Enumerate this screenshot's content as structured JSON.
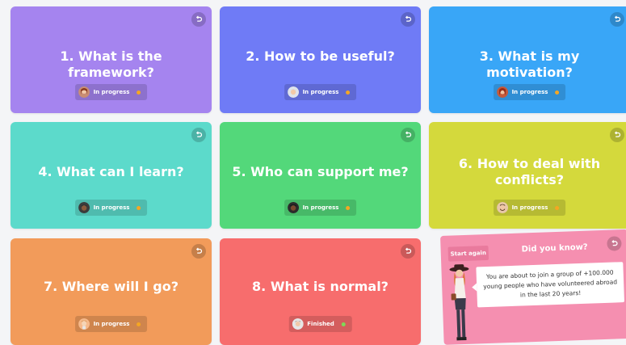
{
  "cards": [
    {
      "title": "1. What is the framework?",
      "status": "In progress",
      "color": "#a584ef",
      "status_color": "in_progress"
    },
    {
      "title": "2. How to be useful?",
      "status": "In progress",
      "color": "#6f7bf6",
      "status_color": "in_progress"
    },
    {
      "title": "3. What is my motivation?",
      "status": "In progress",
      "color": "#39a6f7",
      "status_color": "in_progress"
    },
    {
      "title": "4. What can I learn?",
      "status": "In progress",
      "color": "#5cdacb",
      "status_color": "in_progress"
    },
    {
      "title": "5. Who can support me?",
      "status": "In progress",
      "color": "#53d87a",
      "status_color": "in_progress"
    },
    {
      "title": "6. How to deal with conflicts?",
      "status": "In progress",
      "color": "#d4d93c",
      "status_color": "in_progress"
    },
    {
      "title": "7. Where will I go?",
      "status": "In progress",
      "color": "#f29b5a",
      "status_color": "in_progress"
    },
    {
      "title": "8. What is normal?",
      "status": "Finished",
      "color": "#f76d6d",
      "status_color": "finished"
    }
  ],
  "status_colors": {
    "in_progress": "#f5a623",
    "finished": "#7ed957"
  },
  "did_you_know": {
    "start_label": "Start again",
    "title": "Did you know?",
    "text": "You are about to join a group of +100.000 young people who have volunteered abroad in the last 20 years!",
    "color": "#f58fb0"
  },
  "icons": {
    "card_action": "redo-icon",
    "avatar": "avatar-icon"
  }
}
